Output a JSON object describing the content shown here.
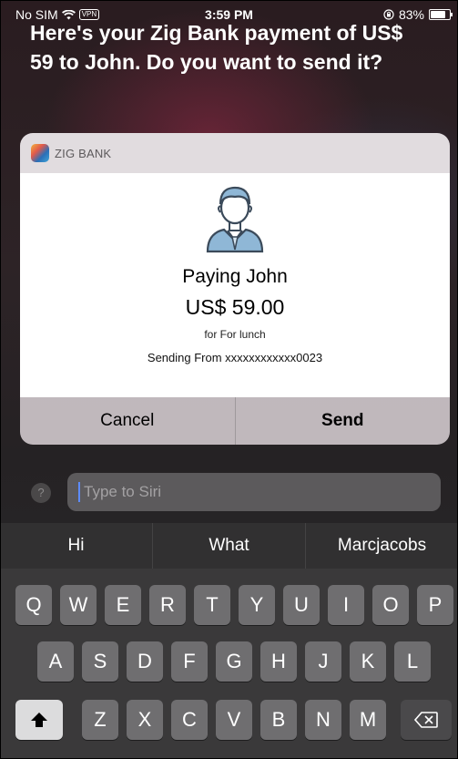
{
  "status_bar": {
    "carrier": "No SIM",
    "vpn": "VPN",
    "time": "3:59 PM",
    "battery": "83%"
  },
  "siri": {
    "response": "Here's your Zig Bank payment of US$ 59 to John. Do you want to send it?",
    "input_placeholder": "Type to Siri",
    "help": "?"
  },
  "card": {
    "app_name": "ZIG BANK",
    "payee": "Paying John",
    "amount": "US$ 59.00",
    "note": "for For lunch",
    "source": "Sending From xxxxxxxxxxxx0023",
    "cancel_label": "Cancel",
    "send_label": "Send"
  },
  "keyboard": {
    "suggestions": [
      "Hi",
      "What",
      "Marcjacobs"
    ],
    "row1": [
      "Q",
      "W",
      "E",
      "R",
      "T",
      "Y",
      "U",
      "I",
      "O",
      "P"
    ],
    "row2": [
      "A",
      "S",
      "D",
      "F",
      "G",
      "H",
      "J",
      "K",
      "L"
    ],
    "row3": [
      "Z",
      "X",
      "C",
      "V",
      "B",
      "N",
      "M"
    ]
  },
  "icons": {
    "wifi": "wifi-icon",
    "orientation_lock": "orientation-lock-icon",
    "battery": "battery-icon",
    "avatar": "person-avatar-icon",
    "shift": "shift-icon",
    "backspace": "backspace-icon"
  },
  "colors": {
    "accent_caret": "#5d8cff",
    "card_header": "#e1dcdf"
  }
}
